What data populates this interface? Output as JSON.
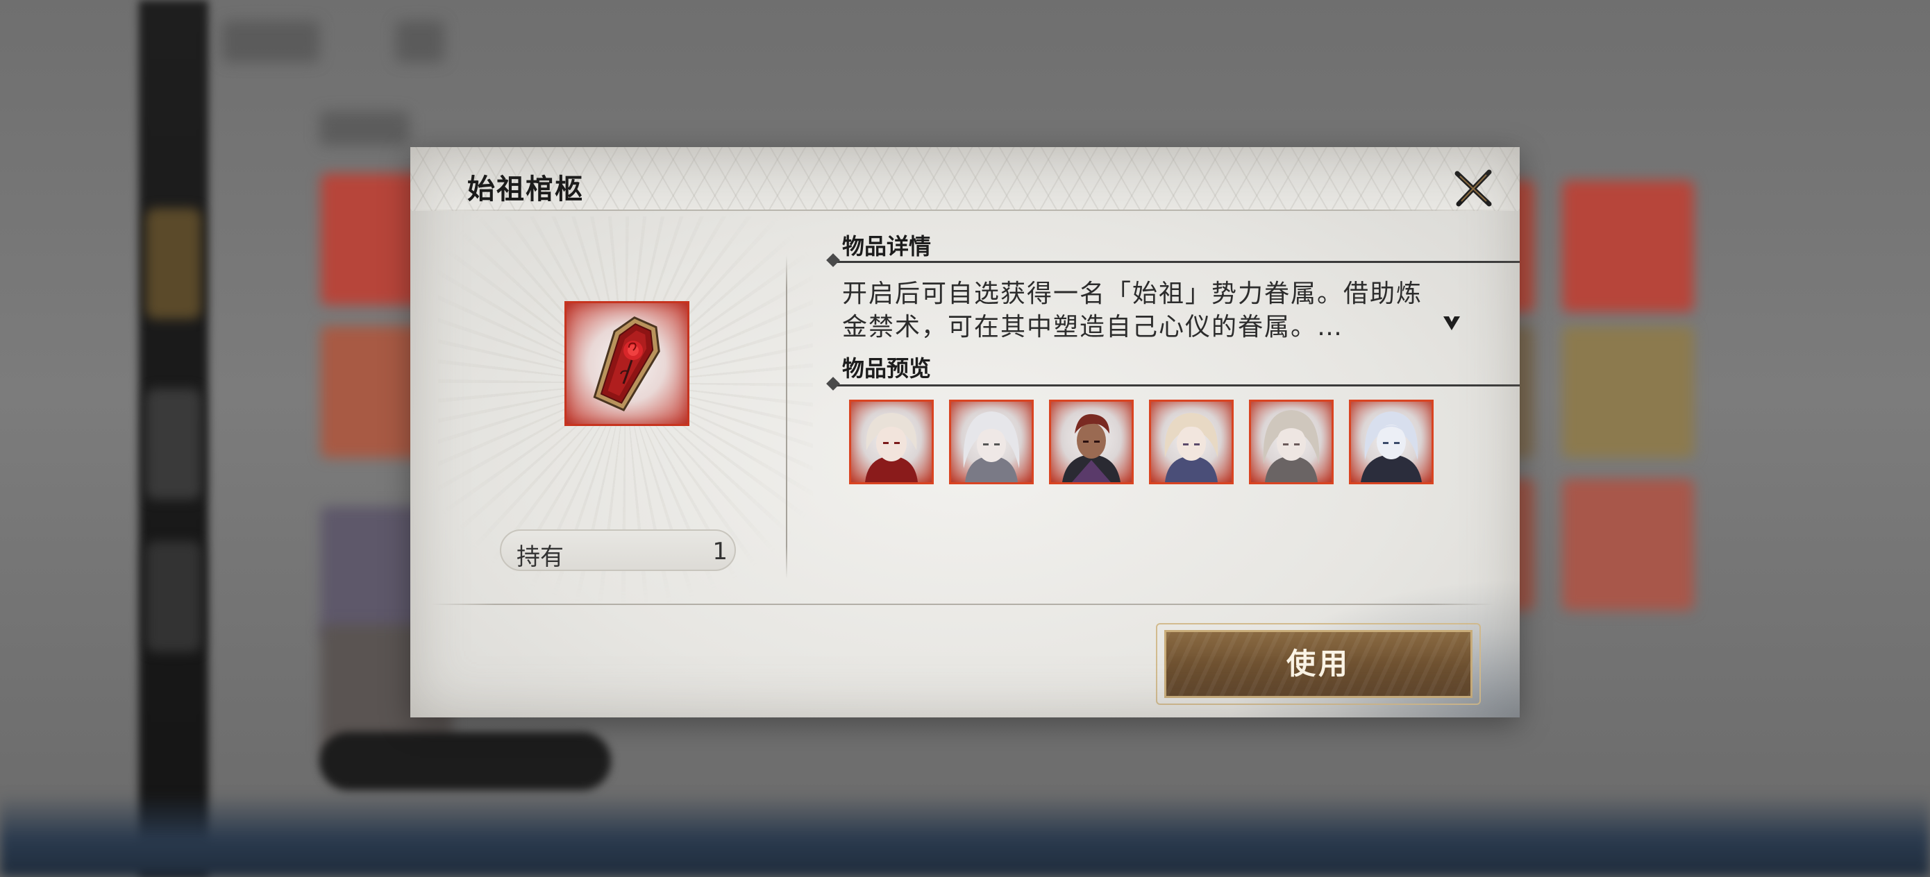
{
  "dialog": {
    "title": "始祖棺柩",
    "close_icon": "close-x-icon"
  },
  "item": {
    "icon": "coffin-with-rose-icon",
    "own_label": "持有",
    "own_count": "1"
  },
  "details": {
    "section_title": "物品详情",
    "description_line1": "开启后可自选获得一名「始祖」势力眷属。借助炼",
    "description_line2": "金禁术，可在其中塑造自己心仪的眷属。…",
    "expand_icon": "expand-arrow-icon"
  },
  "preview": {
    "section_title": "物品预览",
    "avatars": [
      {
        "icon": "character-portrait-icon",
        "hair": "#e9e1d8",
        "accent": "#8a1b1b"
      },
      {
        "icon": "character-portrait-icon",
        "hair": "#e6e6ea",
        "accent": "#7a7a86"
      },
      {
        "icon": "character-portrait-icon",
        "hair": "#7a2a22",
        "accent": "#2a2a32"
      },
      {
        "icon": "character-portrait-icon",
        "hair": "#e8d9c4",
        "accent": "#4a4e78"
      },
      {
        "icon": "character-portrait-icon",
        "hair": "#cfc7bd",
        "accent": "#6a6464"
      },
      {
        "icon": "character-portrait-icon",
        "hair": "#d8dfee",
        "accent": "#2b2d3c"
      }
    ]
  },
  "actions": {
    "use_label": "使用"
  },
  "colors": {
    "rarity_red": "#d94422",
    "button_gold": "#8a6a42",
    "panel": "#e9e8e4"
  }
}
